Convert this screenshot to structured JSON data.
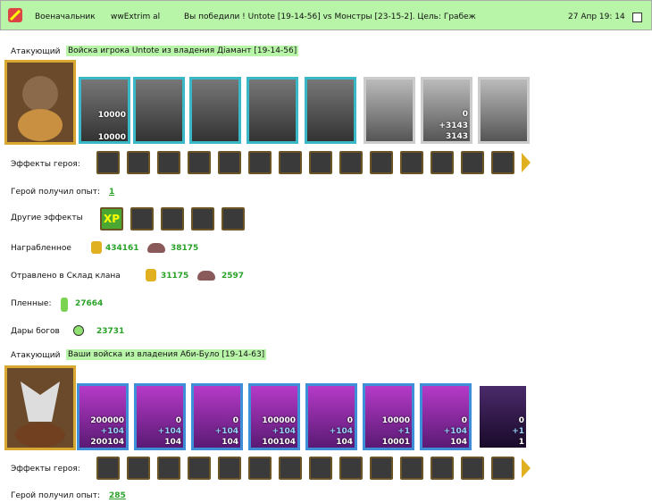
{
  "topbar": {
    "rank": "Военачальник",
    "player": "wwExtrim al",
    "message": "Вы победили ! Untote [19-14-56] vs Монстры [23-15-2]. Цель: Грабеж",
    "datetime": "27 Апр 19: 14"
  },
  "battle1": {
    "role_label": "Атакующий",
    "title": "Войска игрока Untote из владения Діамант [19-14-56]",
    "cards": [
      {
        "top": "",
        "mid": "10000",
        "bottom": "10000"
      },
      {
        "top": "",
        "mid": "",
        "bottom": ""
      },
      {
        "top": "",
        "mid": "",
        "bottom": ""
      },
      {
        "top": "",
        "mid": "",
        "bottom": ""
      },
      {
        "top": "",
        "mid": "",
        "bottom": ""
      },
      {
        "top": "",
        "mid": "",
        "bottom": ""
      },
      {
        "top": "0",
        "mid": "+3143",
        "bottom": "3143"
      },
      {
        "top": "",
        "mid": "",
        "bottom": ""
      }
    ],
    "hero_effects_label": "Эффекты героя:",
    "exp_label": "Герой получил опыт:",
    "exp_value": "1",
    "other_effects_label": "Другие эффекты",
    "other_effects_xp": "XP",
    "loot_label": "Награбленное",
    "loot_gold": "434161",
    "loot_ore": "38175",
    "clan_label": "Отравлено в Склад клана",
    "clan_gold": "31175",
    "clan_ore": "2597",
    "captives_label": "Пленные:",
    "captives_value": "27664",
    "gifts_label": "Дары богов",
    "gifts_value": "23731"
  },
  "battle2": {
    "role_label": "Атакующий",
    "title": "Ваши войска из владения Аби-Було [19-14-63]",
    "cards": [
      {
        "top": "200000",
        "mid": "+104",
        "bottom": "200104"
      },
      {
        "top": "0",
        "mid": "+104",
        "bottom": "104"
      },
      {
        "top": "0",
        "mid": "+104",
        "bottom": "104"
      },
      {
        "top": "100000",
        "mid": "+104",
        "bottom": "100104"
      },
      {
        "top": "0",
        "mid": "+104",
        "bottom": "104"
      },
      {
        "top": "10000",
        "mid": "+1",
        "bottom": "10001"
      },
      {
        "top": "0",
        "mid": "+104",
        "bottom": "104"
      },
      {
        "top": "0",
        "mid": "+1",
        "bottom": "1"
      }
    ],
    "hero_effects_label": "Эффекты героя:",
    "exp_label": "Герой получил опыт:",
    "exp_value": "285"
  },
  "colors": {
    "accent_green": "#b8f5a8",
    "value_green": "#2aa22a"
  }
}
